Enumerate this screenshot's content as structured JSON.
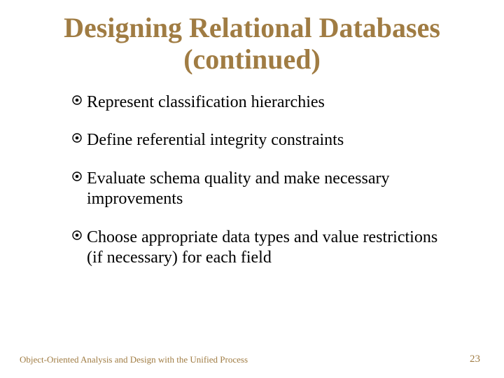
{
  "title_line1": "Designing Relational Databases",
  "title_line2": "(continued)",
  "bullets": [
    "Represent classification hierarchies",
    "Define referential integrity constraints",
    "Evaluate schema quality and make necessary improvements",
    "Choose appropriate data types and value restrictions (if necessary) for each field"
  ],
  "footer_left": "Object-Oriented Analysis and Design with the Unified Process",
  "footer_right": "23",
  "colors": {
    "accent": "#a07c43"
  }
}
